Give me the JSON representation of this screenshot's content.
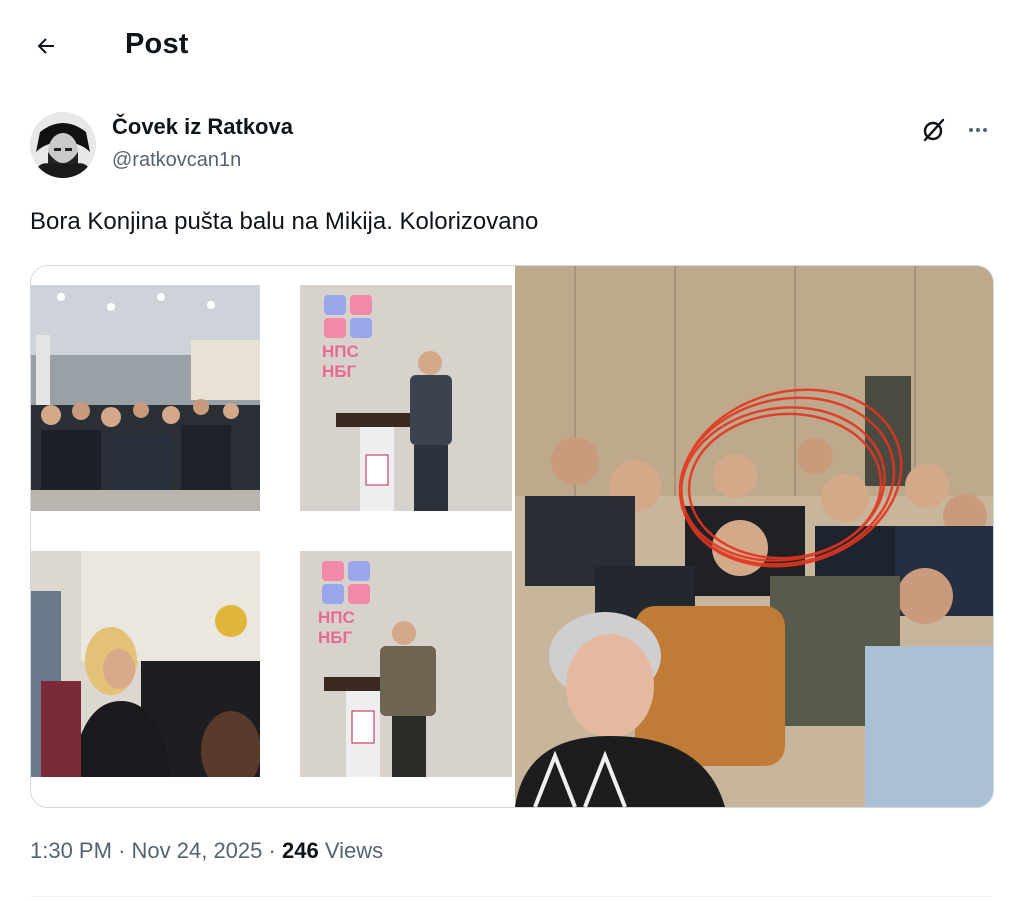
{
  "header": {
    "title": "Post"
  },
  "author": {
    "name": "Čovek iz Ratkova",
    "handle": "@ratkovcan1n"
  },
  "post": {
    "text": "Bora Konjina pušta balu na Mikija. Kolorizovano"
  },
  "media": {
    "signs": [
      {
        "line1": "НПС",
        "line2": "НБГ"
      },
      {
        "line1": "НПС",
        "line2": "НБГ"
      }
    ]
  },
  "meta": {
    "time": "1:30 PM",
    "separator": "·",
    "date": "Nov 24, 2025",
    "views_count": "246",
    "views_label": "Views"
  },
  "colors": {
    "text": "#0f1419",
    "secondary": "#536471",
    "border": "#cfd9de"
  },
  "icons": [
    "back-arrow-icon",
    "grok-icon",
    "more-icon"
  ]
}
